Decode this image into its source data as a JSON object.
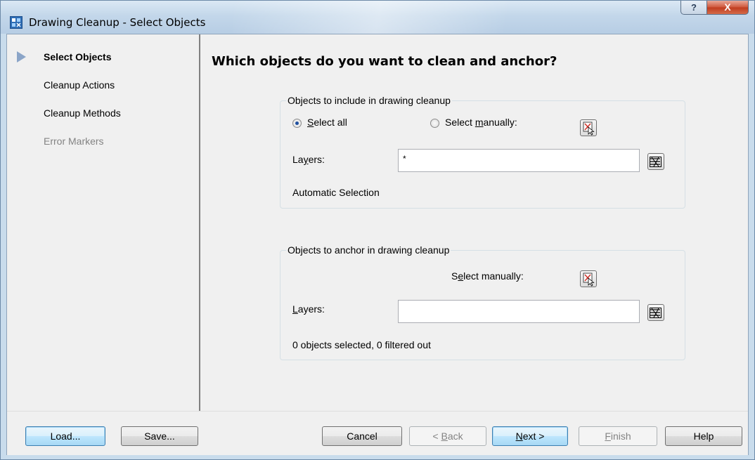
{
  "window": {
    "title": "Drawing Cleanup - Select Objects",
    "help_button": "?",
    "close_button": "X"
  },
  "sidebar": {
    "items": [
      {
        "label": "Select Objects",
        "state": "current"
      },
      {
        "label": "Cleanup Actions",
        "state": "enabled"
      },
      {
        "label": "Cleanup Methods",
        "state": "enabled"
      },
      {
        "label": "Error Markers",
        "state": "disabled"
      }
    ]
  },
  "main": {
    "heading": "Which objects do you want to clean and anchor?",
    "include_group": {
      "title": "Objects to include in drawing cleanup",
      "select_all": {
        "pre": "",
        "key": "S",
        "post": "elect all",
        "selected": true
      },
      "select_manually": {
        "pre": "Select ",
        "key": "m",
        "post": "anually:",
        "selected": false
      },
      "layers_label": {
        "pre": "La",
        "key": "y",
        "post": "ers:"
      },
      "layers_value": "*",
      "status": "Automatic Selection"
    },
    "anchor_group": {
      "title": "Objects to anchor in drawing cleanup",
      "select_manually": {
        "pre": "S",
        "key": "e",
        "post": "lect manually:"
      },
      "layers_label": {
        "pre": "",
        "key": "L",
        "post": "ayers:"
      },
      "layers_value": "",
      "status": "0 objects selected, 0 filtered out"
    }
  },
  "footer": {
    "load": "Load...",
    "save": "Save...",
    "cancel": "Cancel",
    "back": {
      "pre": "< ",
      "key": "B",
      "post": "ack"
    },
    "next": {
      "pre": "",
      "key": "N",
      "post": "ext >"
    },
    "finish": {
      "pre": "",
      "key": "F",
      "post": "inish"
    },
    "help": "Help"
  },
  "colors": {
    "title_bar": "#c3d7ea",
    "close_button": "#c03d1f",
    "nav_arrow": "#8ba5c8",
    "default_button": "#3c7fb1",
    "disabled_text": "#838383"
  }
}
